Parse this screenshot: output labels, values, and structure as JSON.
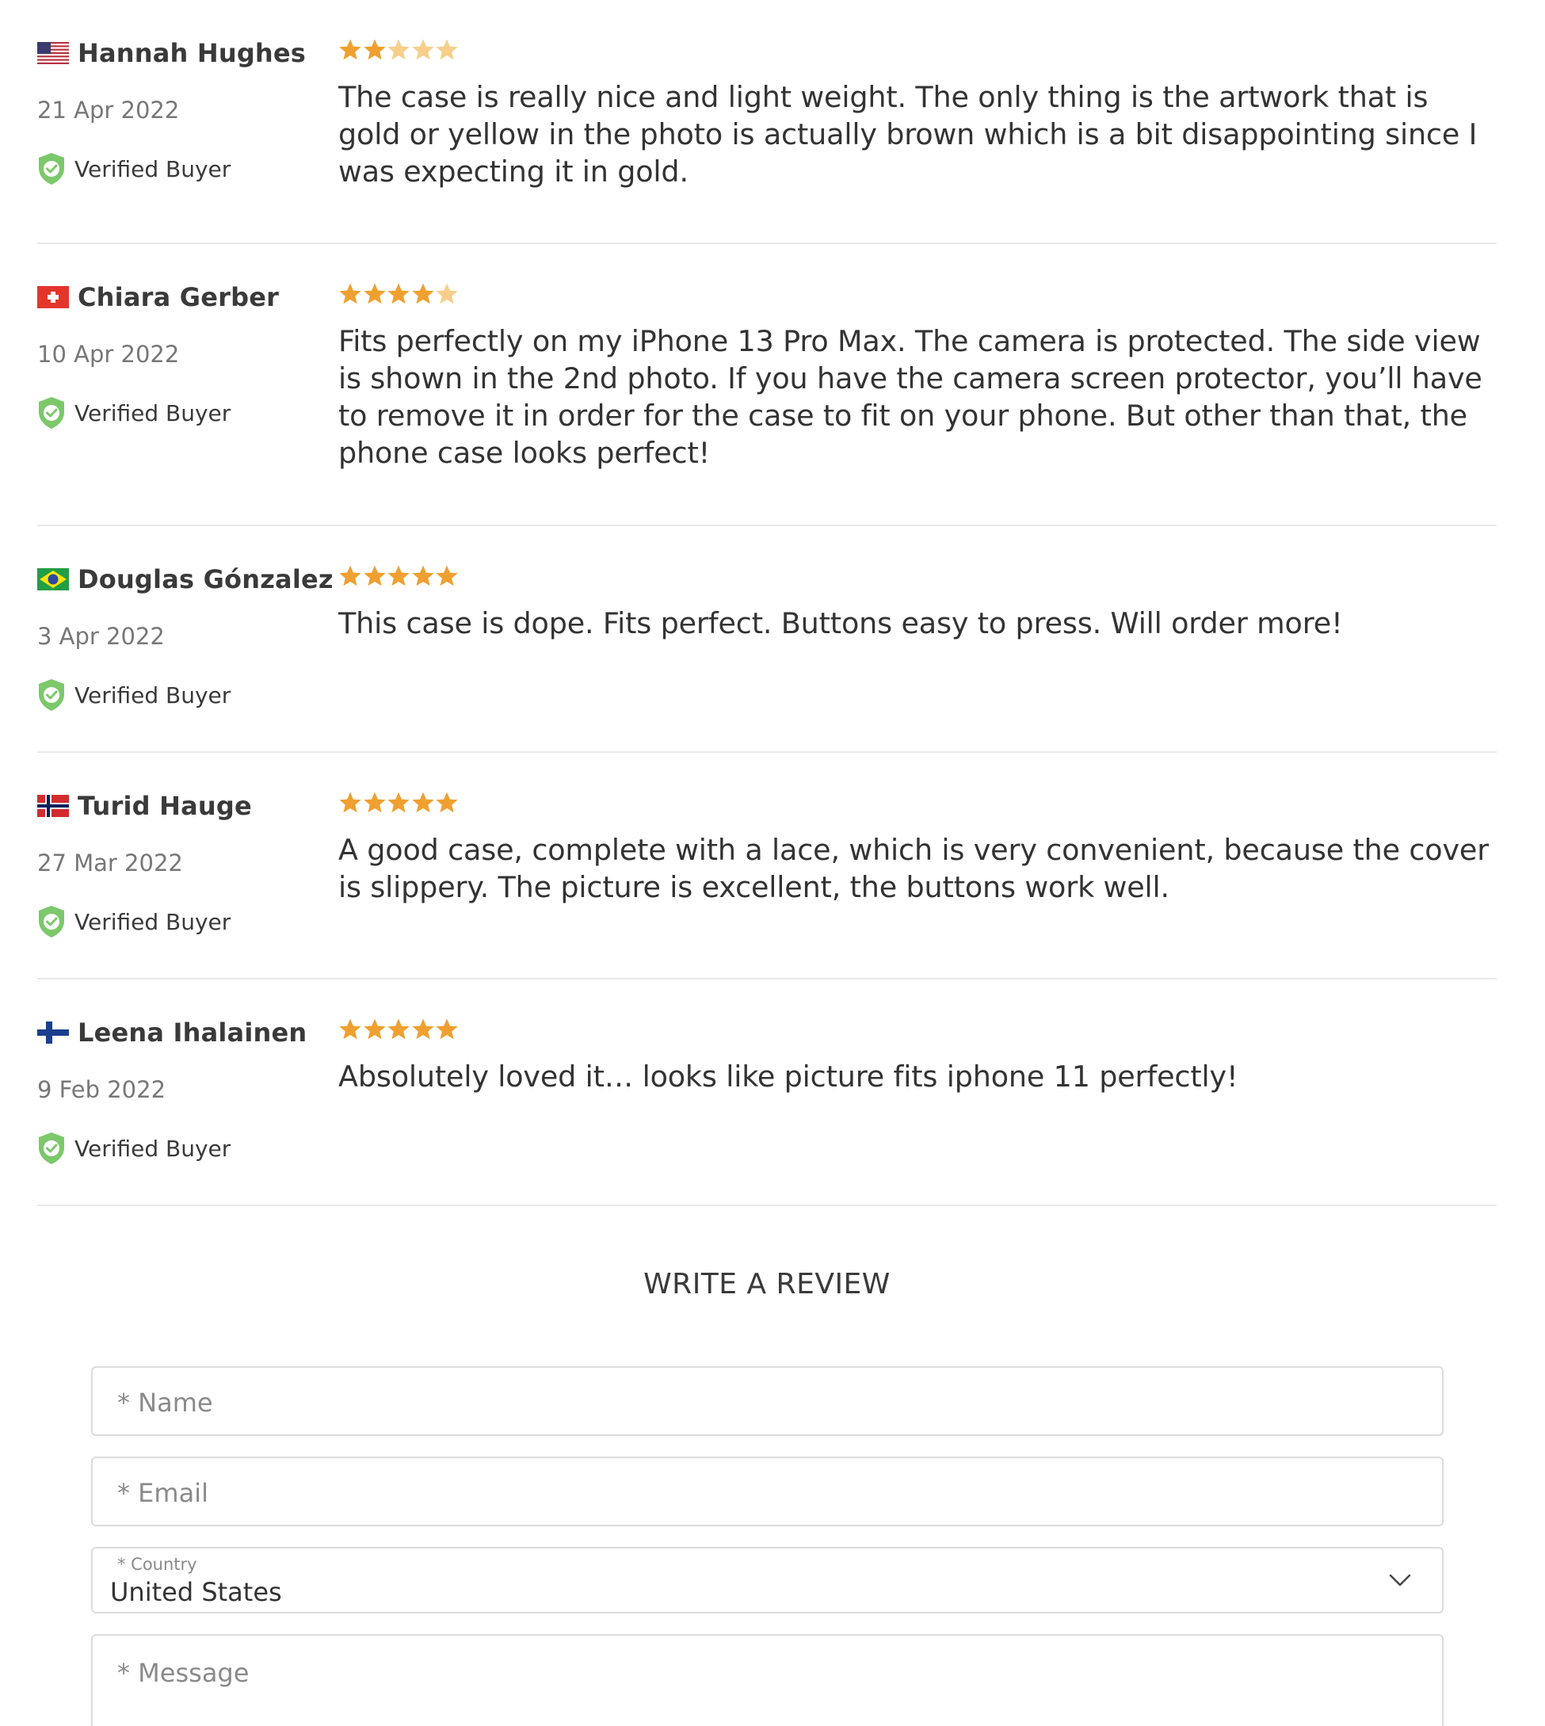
{
  "reviews": [
    {
      "name": "Hannah Hughes",
      "country": "United States",
      "flag_icon": "us-flag-icon",
      "date": "21 Apr 2022",
      "verified_label": "Verified Buyer",
      "rating": 2,
      "text": "The case is really nice and light weight. The only thing is the artwork that is gold or yellow in the photo is actually brown which is a bit disappointing since I was expecting it in gold."
    },
    {
      "name": "Chiara Gerber",
      "country": "Switzerland",
      "flag_icon": "ch-flag-icon",
      "date": "10 Apr 2022",
      "verified_label": "Verified Buyer",
      "rating": 4,
      "text": "Fits perfectly on my iPhone 13 Pro Max. The camera is protected. The side view is shown in the 2nd photo. If you have the camera screen protector, you’ll have to remove it in order for the case to fit on your phone. But other than that, the phone case looks perfect!"
    },
    {
      "name": "Douglas Gónzalez",
      "country": "Brazil",
      "flag_icon": "br-flag-icon",
      "date": "3 Apr 2022",
      "verified_label": "Verified Buyer",
      "rating": 5,
      "text": "This case is dope. Fits perfect. Buttons easy to press. Will order more!"
    },
    {
      "name": "Turid Hauge",
      "country": "Norway",
      "flag_icon": "no-flag-icon",
      "date": "27 Mar 2022",
      "verified_label": "Verified Buyer",
      "rating": 5,
      "text": "A good case, complete with a lace, which is very convenient, because the cover is slippery. The picture is excellent, the buttons work well."
    },
    {
      "name": "Leena Ihalainen",
      "country": "Finland",
      "flag_icon": "fi-flag-icon",
      "date": "9 Feb 2022",
      "verified_label": "Verified Buyer",
      "rating": 5,
      "text": "Absolutely loved it… looks like picture fits iphone 11 perfectly!"
    }
  ],
  "write_review": {
    "title": "WRITE A REVIEW",
    "name_placeholder": "* Name",
    "email_placeholder": "* Email",
    "country_label": "* Country",
    "country_value": "United States",
    "message_placeholder": "* Message"
  },
  "colors": {
    "star_filled": "#f0a030",
    "star_empty": "#f7cf8a",
    "verified_green": "#7cc86b",
    "divider": "#e9e9e9"
  }
}
